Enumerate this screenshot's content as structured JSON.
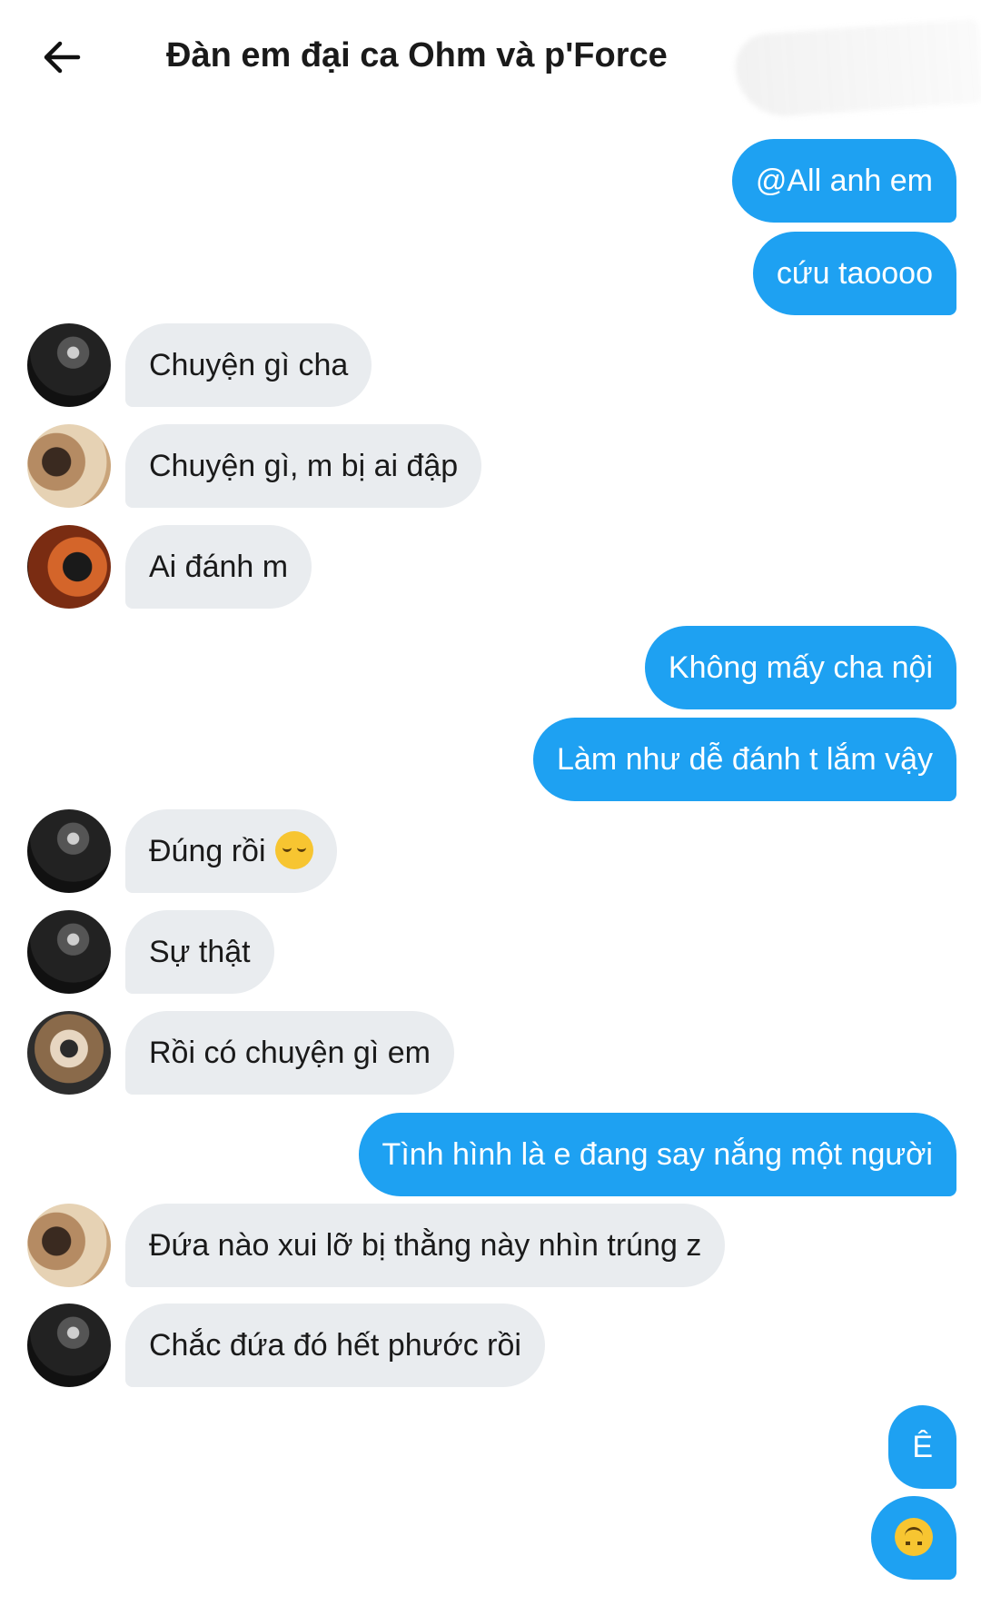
{
  "header": {
    "title": "Đàn em đại ca Ohm và p'Force"
  },
  "colors": {
    "outgoing_bubble": "#1ea1f2",
    "incoming_bubble": "#e9ecef"
  },
  "messages": [
    {
      "direction": "out",
      "text": "@All anh em"
    },
    {
      "direction": "out",
      "text": "cứu taoooo"
    },
    {
      "direction": "in",
      "text": "Chuyện gì cha",
      "avatar": "avatar-a"
    },
    {
      "direction": "in",
      "text": "Chuyện gì, m bị ai đập",
      "avatar": "avatar-b"
    },
    {
      "direction": "in",
      "text": "Ai đánh m",
      "avatar": "avatar-c"
    },
    {
      "direction": "out",
      "text": "Không mấy cha nội"
    },
    {
      "direction": "out",
      "text": "Làm như dễ đánh t lắm vậy"
    },
    {
      "direction": "in",
      "text": "Đúng rồi",
      "emoji": "relieved-face-emoji",
      "avatar": "avatar-a"
    },
    {
      "direction": "in",
      "text": "Sự thật",
      "avatar": "avatar-a"
    },
    {
      "direction": "in",
      "text": "Rồi có chuyện gì em",
      "avatar": "avatar-d"
    },
    {
      "direction": "out",
      "text": "Tình hình là e đang say nắng một người"
    },
    {
      "direction": "in",
      "text": "Đứa nào xui lỡ bị thằng này nhìn trúng z",
      "avatar": "avatar-b"
    },
    {
      "direction": "in",
      "text": "Chắc đứa đó hết phước rồi",
      "avatar": "avatar-a"
    },
    {
      "direction": "out",
      "text": "Ê"
    },
    {
      "direction": "out",
      "emoji": "upside-down-face-emoji"
    }
  ]
}
